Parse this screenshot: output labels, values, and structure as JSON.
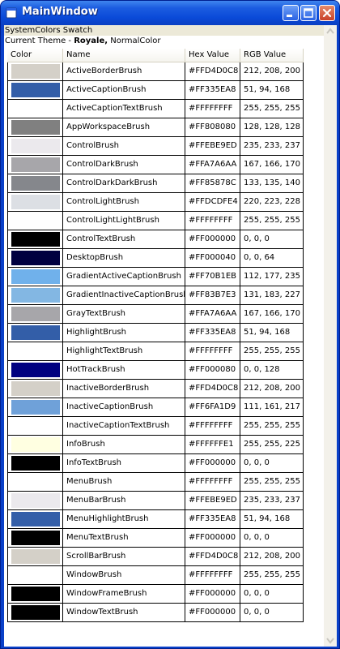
{
  "window": {
    "title": "MainWindow"
  },
  "header": {
    "line1": "SystemColors Swatch",
    "line2_prefix": "Current Theme - ",
    "theme_name": "Royale,",
    "color_name": "NormalColor"
  },
  "columns": {
    "color": "Color",
    "name": "Name",
    "hex": "Hex Value",
    "rgb": "RGB Value"
  },
  "rows": [
    {
      "name": "ActiveBorderBrush",
      "hex": "#FFD4D0C8",
      "rgb": "212, 208, 200",
      "color": "#d4d0c8"
    },
    {
      "name": "ActiveCaptionBrush",
      "hex": "#FF335EA8",
      "rgb": "51, 94, 168",
      "color": "#335ea8"
    },
    {
      "name": "ActiveCaptionTextBrush",
      "hex": "#FFFFFFFF",
      "rgb": "255, 255, 255",
      "color": "#ffffff"
    },
    {
      "name": "AppWorkspaceBrush",
      "hex": "#FF808080",
      "rgb": "128, 128, 128",
      "color": "#808080"
    },
    {
      "name": "ControlBrush",
      "hex": "#FFEBE9ED",
      "rgb": "235, 233, 237",
      "color": "#ebe9ed"
    },
    {
      "name": "ControlDarkBrush",
      "hex": "#FFA7A6AA",
      "rgb": "167, 166, 170",
      "color": "#a7a6aa"
    },
    {
      "name": "ControlDarkDarkBrush",
      "hex": "#FF85878C",
      "rgb": "133, 135, 140",
      "color": "#85878c"
    },
    {
      "name": "ControlLightBrush",
      "hex": "#FFDCDFE4",
      "rgb": "220, 223, 228",
      "color": "#dcdfe4"
    },
    {
      "name": "ControlLightLightBrush",
      "hex": "#FFFFFFFF",
      "rgb": "255, 255, 255",
      "color": "#ffffff"
    },
    {
      "name": "ControlTextBrush",
      "hex": "#FF000000",
      "rgb": "0, 0, 0",
      "color": "#000000"
    },
    {
      "name": "DesktopBrush",
      "hex": "#FF000040",
      "rgb": "0, 0, 64",
      "color": "#000040"
    },
    {
      "name": "GradientActiveCaptionBrush",
      "hex": "#FF70B1EB",
      "rgb": "112, 177, 235",
      "color": "#70b1eb"
    },
    {
      "name": "GradientInactiveCaptionBrush",
      "hex": "#FF83B7E3",
      "rgb": "131, 183, 227",
      "color": "#83b7e3"
    },
    {
      "name": "GrayTextBrush",
      "hex": "#FFA7A6AA",
      "rgb": "167, 166, 170",
      "color": "#a7a6aa"
    },
    {
      "name": "HighlightBrush",
      "hex": "#FF335EA8",
      "rgb": "51, 94, 168",
      "color": "#335ea8"
    },
    {
      "name": "HighlightTextBrush",
      "hex": "#FFFFFFFF",
      "rgb": "255, 255, 255",
      "color": "#ffffff"
    },
    {
      "name": "HotTrackBrush",
      "hex": "#FF000080",
      "rgb": "0, 0, 128",
      "color": "#000080"
    },
    {
      "name": "InactiveBorderBrush",
      "hex": "#FFD4D0C8",
      "rgb": "212, 208, 200",
      "color": "#d4d0c8"
    },
    {
      "name": "InactiveCaptionBrush",
      "hex": "#FF6FA1D9",
      "rgb": "111, 161, 217",
      "color": "#6fa1d9"
    },
    {
      "name": "InactiveCaptionTextBrush",
      "hex": "#FFFFFFFF",
      "rgb": "255, 255, 255",
      "color": "#ffffff"
    },
    {
      "name": "InfoBrush",
      "hex": "#FFFFFFE1",
      "rgb": "255, 255, 225",
      "color": "#ffffe1"
    },
    {
      "name": "InfoTextBrush",
      "hex": "#FF000000",
      "rgb": "0, 0, 0",
      "color": "#000000"
    },
    {
      "name": "MenuBrush",
      "hex": "#FFFFFFFF",
      "rgb": "255, 255, 255",
      "color": "#ffffff"
    },
    {
      "name": "MenuBarBrush",
      "hex": "#FFEBE9ED",
      "rgb": "235, 233, 237",
      "color": "#ebe9ed"
    },
    {
      "name": "MenuHighlightBrush",
      "hex": "#FF335EA8",
      "rgb": "51, 94, 168",
      "color": "#335ea8"
    },
    {
      "name": "MenuTextBrush",
      "hex": "#FF000000",
      "rgb": "0, 0, 0",
      "color": "#000000"
    },
    {
      "name": "ScrollBarBrush",
      "hex": "#FFD4D0C8",
      "rgb": "212, 208, 200",
      "color": "#d4d0c8"
    },
    {
      "name": "WindowBrush",
      "hex": "#FFFFFFFF",
      "rgb": "255, 255, 255",
      "color": "#ffffff"
    },
    {
      "name": "WindowFrameBrush",
      "hex": "#FF000000",
      "rgb": "0, 0, 0",
      "color": "#000000"
    },
    {
      "name": "WindowTextBrush",
      "hex": "#FF000000",
      "rgb": "0, 0, 0",
      "color": "#000000"
    }
  ]
}
